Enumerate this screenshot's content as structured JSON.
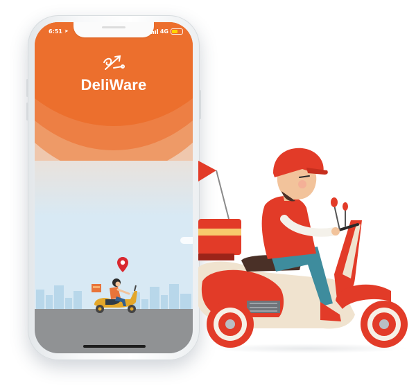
{
  "status_bar": {
    "time": "6:51",
    "network": "4G"
  },
  "app": {
    "name": "DeliWare",
    "logo_icon": "delivery-arrows-logo-icon"
  },
  "colors": {
    "brand_orange": "#ec6f2d",
    "sky": "#d8e9f4",
    "road": "#909294",
    "scooter_red": "#e23b28"
  },
  "illustration": {
    "subject": "delivery-rider-on-scooter",
    "map_pin_icon": "location-pin-icon"
  }
}
